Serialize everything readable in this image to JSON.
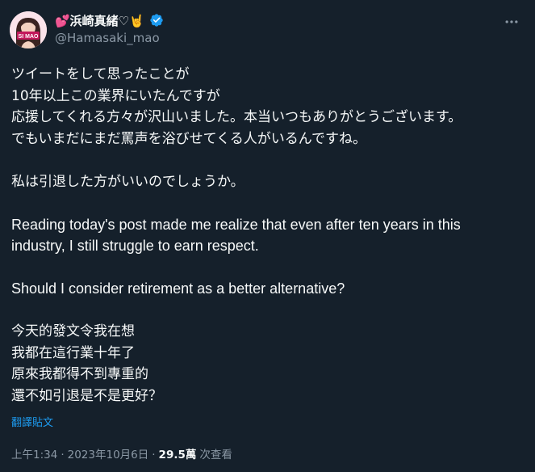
{
  "author": {
    "display_name": "💕浜崎真緒♡🤘",
    "handle": "@Hamasaki_mao",
    "avatar_label": "SI MAO",
    "verified": true,
    "verified_color": "#1d9bf0"
  },
  "tweet": {
    "lines": [
      "ツイートをして思ったことが",
      "10年以上この業界にいたんですが",
      "応援してくれる方々が沢山いました。本当いつもありがとうございます。",
      "でもいまだにまだ罵声を浴びせてくる人がいるんですね。",
      "",
      "私は引退した方がいいのでしょうか。",
      "",
      "Reading today's post made me realize that even after ten years in this",
      "industry, I still struggle to earn respect.",
      "",
      "Should I consider retirement as a better alternative?",
      "",
      "今天的發文令我在想",
      "我都在這行業十年了",
      "原來我都得不到專重的",
      "還不如引退是不是更好？"
    ],
    "translate_label": "翻譯貼文"
  },
  "meta": {
    "time": "上午1:34",
    "separator": "·",
    "date": "2023年10月6日",
    "views_count": "29.5萬",
    "views_label": "次查看"
  },
  "icons": {
    "more": "more-horizontal-icon",
    "verified": "verified-badge-icon"
  },
  "colors": {
    "background": "#15202b",
    "text": "#f7f9f9",
    "secondary": "#8b98a5",
    "link": "#1d9bf0"
  }
}
